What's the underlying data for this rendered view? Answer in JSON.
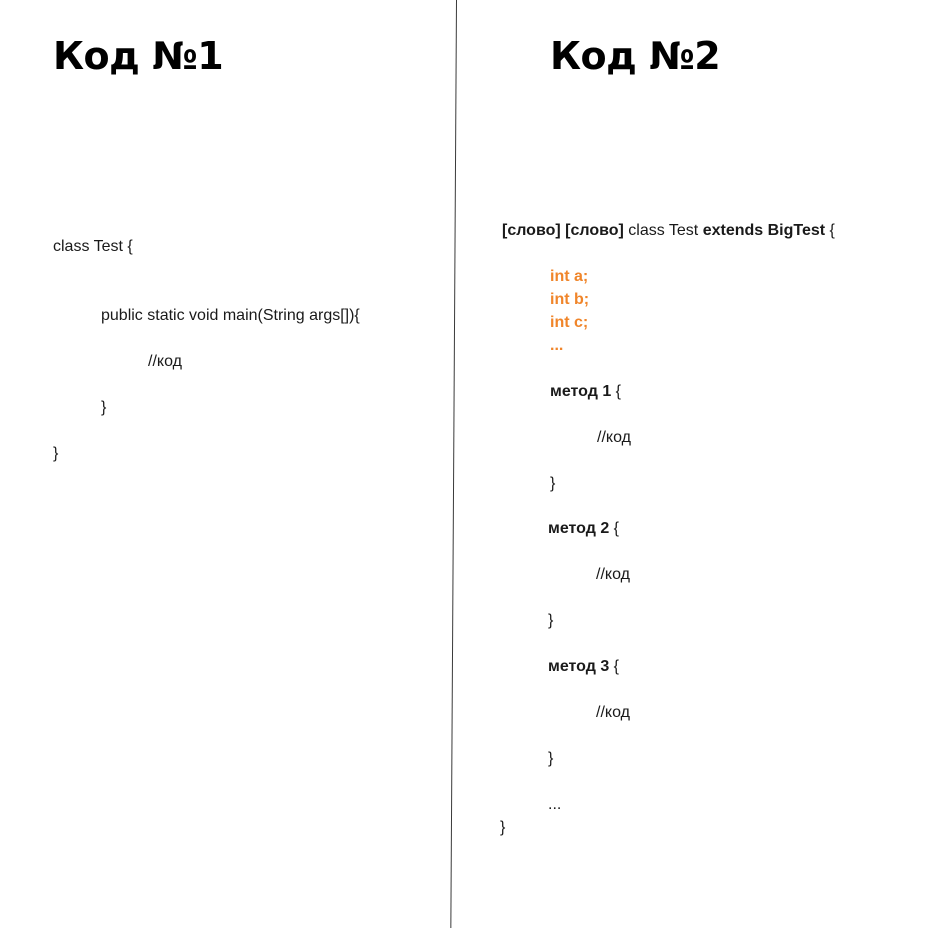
{
  "left": {
    "title": "Код №1",
    "code": {
      "class_decl": "class Test {",
      "main_decl": "public static void main(String args[]){",
      "comment": "//код",
      "inner_close": "}",
      "outer_close": "}"
    }
  },
  "right": {
    "title": "Код №2",
    "code": {
      "modifier_1": "[слово]",
      "modifier_2": "[слово]",
      "class_word": "class Test",
      "extends_word": "extends BigTest",
      "open_brace": "{",
      "fields": [
        "int a;",
        "int b;",
        "int c;",
        "..."
      ],
      "methods": [
        {
          "name": "метод 1",
          "open": "{",
          "comment": "//код",
          "close": "}"
        },
        {
          "name": "метод 2",
          "open": "{",
          "comment": "//код",
          "close": "}"
        },
        {
          "name": "метод 3",
          "open": "{",
          "comment": "//код",
          "close": "}"
        }
      ],
      "ellipsis": "...",
      "outer_close": "}"
    },
    "colors": {
      "field_color": "#f0852a"
    }
  }
}
